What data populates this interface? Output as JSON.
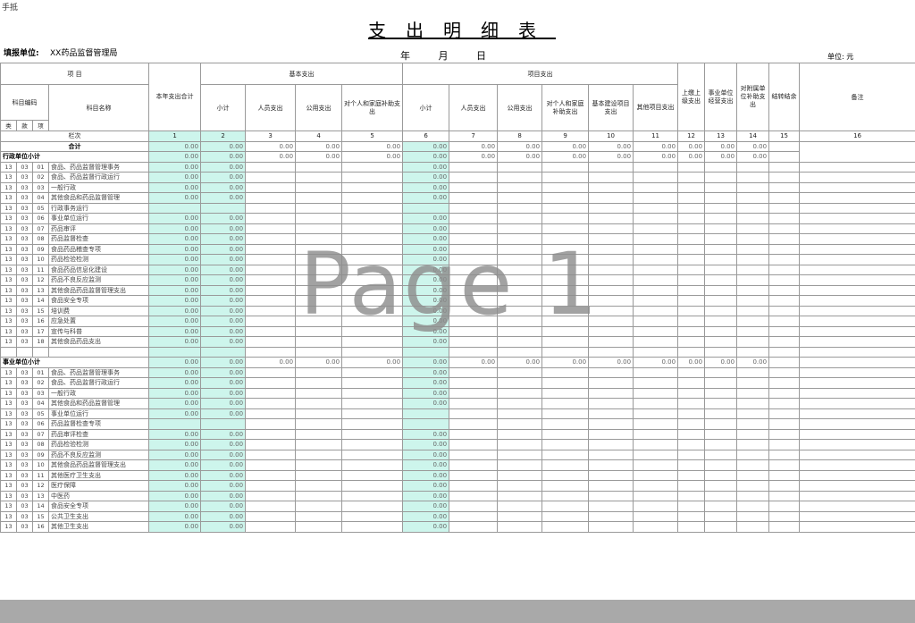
{
  "tab_label": "手抵",
  "title": "支出明细表",
  "unit_label": "填报单位:",
  "unit_name": "XX药品监督管理局",
  "date_label": "年 月 日",
  "currency": "单位: 元",
  "watermark": "Page 1",
  "header": {
    "subject": "项 目",
    "code": "科目编码",
    "name": "科目名称",
    "kind": [
      "类",
      "款",
      "项"
    ],
    "total_label": "本年支出合计",
    "basic_group": "基本支出",
    "project_group": "项目支出",
    "subtotal": "小计",
    "personnel": "人员支出",
    "public": "公用支出",
    "subsidy": "对个人和家庭补助支出",
    "capital": "基本建设项目支出",
    "other_project": "其他项目支出",
    "upper": "上缴上级支出",
    "business": "事业单位经营支出",
    "lower": "对附属单位补助支出",
    "other_fund": "结转结余",
    "remark": "备注",
    "column_label": "栏次",
    "numbers": [
      "1",
      "2",
      "3",
      "4",
      "5",
      "6",
      "7",
      "8",
      "9",
      "10",
      "11",
      "12",
      "13",
      "14",
      "15",
      "16"
    ]
  },
  "total_row": {
    "label": "合计",
    "value": "0.00"
  },
  "sections": [
    {
      "title": "行政单位小计",
      "rows": [
        [
          "13",
          "03",
          "01",
          "食品、药品监督管理事务",
          "0.00",
          "0.00",
          "",
          "",
          "",
          "0.00"
        ],
        [
          "13",
          "03",
          "02",
          "食品、药品监督行政运行",
          "0.00",
          "0.00",
          "",
          "",
          "",
          "0.00"
        ],
        [
          "13",
          "03",
          "03",
          "一般行政",
          "0.00",
          "0.00",
          "",
          "",
          "",
          "0.00"
        ],
        [
          "13",
          "03",
          "04",
          "其他食品和药品监督管理",
          "0.00",
          "0.00",
          "",
          "",
          "",
          "0.00"
        ],
        [
          "13",
          "03",
          "05",
          "行政事务运行",
          "",
          "",
          "",
          "",
          "",
          ""
        ],
        [
          "13",
          "03",
          "06",
          "事业单位运行",
          "0.00",
          "0.00",
          "",
          "",
          "",
          "0.00"
        ],
        [
          "13",
          "03",
          "07",
          "药品审评",
          "0.00",
          "0.00",
          "",
          "",
          "",
          "0.00"
        ],
        [
          "13",
          "03",
          "08",
          "药品监督检查",
          "0.00",
          "0.00",
          "",
          "",
          "",
          "0.00"
        ],
        [
          "13",
          "03",
          "09",
          "食品药品稽查专项",
          "0.00",
          "0.00",
          "",
          "",
          "",
          "0.00"
        ],
        [
          "13",
          "03",
          "10",
          "药品检验检测",
          "0.00",
          "0.00",
          "",
          "",
          "",
          "0.00"
        ],
        [
          "13",
          "03",
          "11",
          "食品药品信息化建设",
          "0.00",
          "0.00",
          "",
          "",
          "",
          "0.00"
        ],
        [
          "13",
          "03",
          "12",
          "药品不良反应监测",
          "0.00",
          "0.00",
          "",
          "",
          "",
          "0.00"
        ],
        [
          "13",
          "03",
          "13",
          "其他食品药品监督管理支出",
          "0.00",
          "0.00",
          "",
          "",
          "",
          "0.00"
        ],
        [
          "13",
          "03",
          "14",
          "食品安全专项",
          "0.00",
          "0.00",
          "",
          "",
          "",
          "0.00"
        ],
        [
          "13",
          "03",
          "15",
          "培训费",
          "0.00",
          "0.00",
          "",
          "",
          "",
          "0.00"
        ],
        [
          "13",
          "03",
          "16",
          "应急处置",
          "0.00",
          "0.00",
          "",
          "",
          "",
          "0.00"
        ],
        [
          "13",
          "03",
          "17",
          "宣传与科普",
          "0.00",
          "0.00",
          "",
          "",
          "",
          "0.00"
        ],
        [
          "13",
          "03",
          "18",
          "其他食品药品支出",
          "0.00",
          "0.00",
          "",
          "",
          "",
          "0.00"
        ]
      ]
    },
    {
      "title": "事业单位小计",
      "rows": [
        [
          "13",
          "03",
          "01",
          "食品、药品监督管理事务",
          "0.00",
          "0.00",
          "",
          "",
          "",
          "0.00"
        ],
        [
          "13",
          "03",
          "02",
          "食品、药品监督行政运行",
          "0.00",
          "0.00",
          "",
          "",
          "",
          "0.00"
        ],
        [
          "13",
          "03",
          "03",
          "一般行政",
          "0.00",
          "0.00",
          "",
          "",
          "",
          "0.00"
        ],
        [
          "13",
          "03",
          "04",
          "其他食品和药品监督管理",
          "0.00",
          "0.00",
          "",
          "",
          "",
          "0.00"
        ],
        [
          "13",
          "03",
          "05",
          "事业单位运行",
          "0.00",
          "0.00",
          "",
          "",
          "",
          ""
        ],
        [
          "13",
          "03",
          "06",
          "药品监督检查专项",
          "",
          "",
          "",
          "",
          "",
          ""
        ],
        [
          "13",
          "03",
          "07",
          "药品审评检查",
          "0.00",
          "0.00",
          "",
          "",
          "",
          "0.00"
        ],
        [
          "13",
          "03",
          "08",
          "药品检验检测",
          "0.00",
          "0.00",
          "",
          "",
          "",
          "0.00"
        ],
        [
          "13",
          "03",
          "09",
          "药品不良反应监测",
          "0.00",
          "0.00",
          "",
          "",
          "",
          "0.00"
        ],
        [
          "13",
          "03",
          "10",
          "其他食品药品监督管理支出",
          "0.00",
          "0.00",
          "",
          "",
          "",
          "0.00"
        ],
        [
          "13",
          "03",
          "11",
          "其他医疗卫生支出",
          "0.00",
          "0.00",
          "",
          "",
          "",
          "0.00"
        ],
        [
          "13",
          "03",
          "12",
          "医疗保障",
          "0.00",
          "0.00",
          "",
          "",
          "",
          "0.00"
        ],
        [
          "13",
          "03",
          "13",
          "中医药",
          "0.00",
          "0.00",
          "",
          "",
          "",
          "0.00"
        ],
        [
          "13",
          "03",
          "14",
          "食品安全专项",
          "0.00",
          "0.00",
          "",
          "",
          "",
          "0.00"
        ],
        [
          "13",
          "03",
          "15",
          "公共卫生支出",
          "0.00",
          "0.00",
          "",
          "",
          "",
          "0.00"
        ],
        [
          "13",
          "03",
          "16",
          "其他卫生支出",
          "0.00",
          "0.00",
          "",
          "",
          "",
          "0.00"
        ]
      ]
    }
  ],
  "colors": {
    "highlight": "#cdf5ec",
    "border": "#9a9a9a",
    "footer_bar": "#a9a9a9"
  }
}
